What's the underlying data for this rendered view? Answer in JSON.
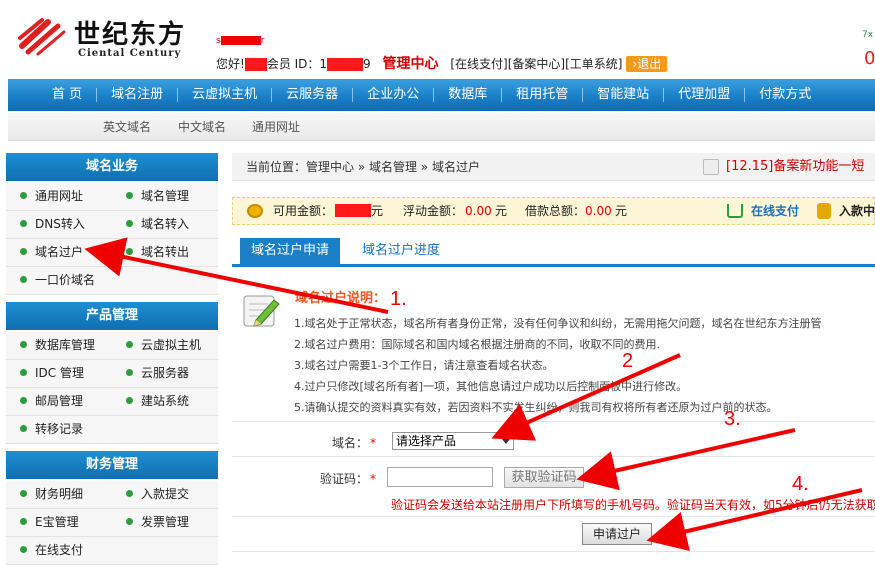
{
  "logo": {
    "cn": "世纪东方",
    "en": "Ciental Century"
  },
  "user": {
    "greeting": "您好!",
    "member_id_label": "会员 ID：1",
    "member_id_suffix": "9",
    "center": "管理中心",
    "links": [
      "[在线支付]",
      "[备案中心]",
      "[工单系统]"
    ],
    "logout": "退出",
    "top_fragment_a": "7x",
    "top_fragment_b": "0"
  },
  "nav": [
    "首 页",
    "域名注册",
    "云虚拟主机",
    "云服务器",
    "企业办公",
    "数据库",
    "租用托管",
    "智能建站",
    "代理加盟",
    "付款方式"
  ],
  "subnav": [
    "英文域名",
    "中文域名",
    "通用网址"
  ],
  "sidebar": {
    "sections": [
      {
        "title": "域名业务",
        "items": [
          "通用网址",
          "域名管理",
          "DNS转入",
          "域名转入",
          "域名过户",
          "域名转出",
          "一口价域名"
        ]
      },
      {
        "title": "产品管理",
        "items": [
          "数据库管理",
          "云虚拟主机",
          "IDC 管理",
          "云服务器",
          "邮局管理",
          "建站系统",
          "转移记录"
        ]
      },
      {
        "title": "财务管理",
        "items": [
          "财务明细",
          "入款提交",
          "E宝管理",
          "发票管理",
          "在线支付"
        ]
      }
    ]
  },
  "breadcrumb": "当前位置：管理中心 » 域名管理 » 域名过户",
  "notice": "[12.15]备案新功能一短",
  "balance": {
    "available_label": "可用金额：",
    "available_unit": "元",
    "float_label": "浮动金额：",
    "float_value": "0.00",
    "float_unit": "元",
    "loan_label": "借款总额：",
    "loan_value": "0.00",
    "loan_unit": "元",
    "pay_online": "在线支付",
    "deposit": "入款中"
  },
  "tabs": [
    "域名过户申请",
    "域名过户进度"
  ],
  "description": {
    "title": "域名过户说明：",
    "items": [
      "1.域名处于正常状态，域名所有者身份正常，没有任何争议和纠纷，无需用拖欠问题，域名在世纪东方注册管",
      "2.域名过户费用：国际域名和国内域名根据注册商的不同，收取不同的费用.",
      "3.域名过户需要1-3个工作日，请注意查看域名状态。",
      "4.过户只修改[域名所有者]一项，其他信息请过户成功以后控制面板中进行修改。",
      "5.请确认提交的资料真实有效，若因资料不实发生纠纷，则我司有权将所有者还原为过户前的状态。"
    ]
  },
  "form": {
    "domain_label": "域名：",
    "domain_select": "请选择产品",
    "code_label": "验证码：",
    "code_value": "",
    "get_code_button": "获取验证码",
    "code_note": "验证码会发送给本站注册用户下所填写的手机号码。验证码当天有效，如5分钟后仍无法获取",
    "submit": "申请过户",
    "required_mark": "*"
  },
  "annotations": [
    "1.",
    "2",
    "3.",
    "4."
  ]
}
